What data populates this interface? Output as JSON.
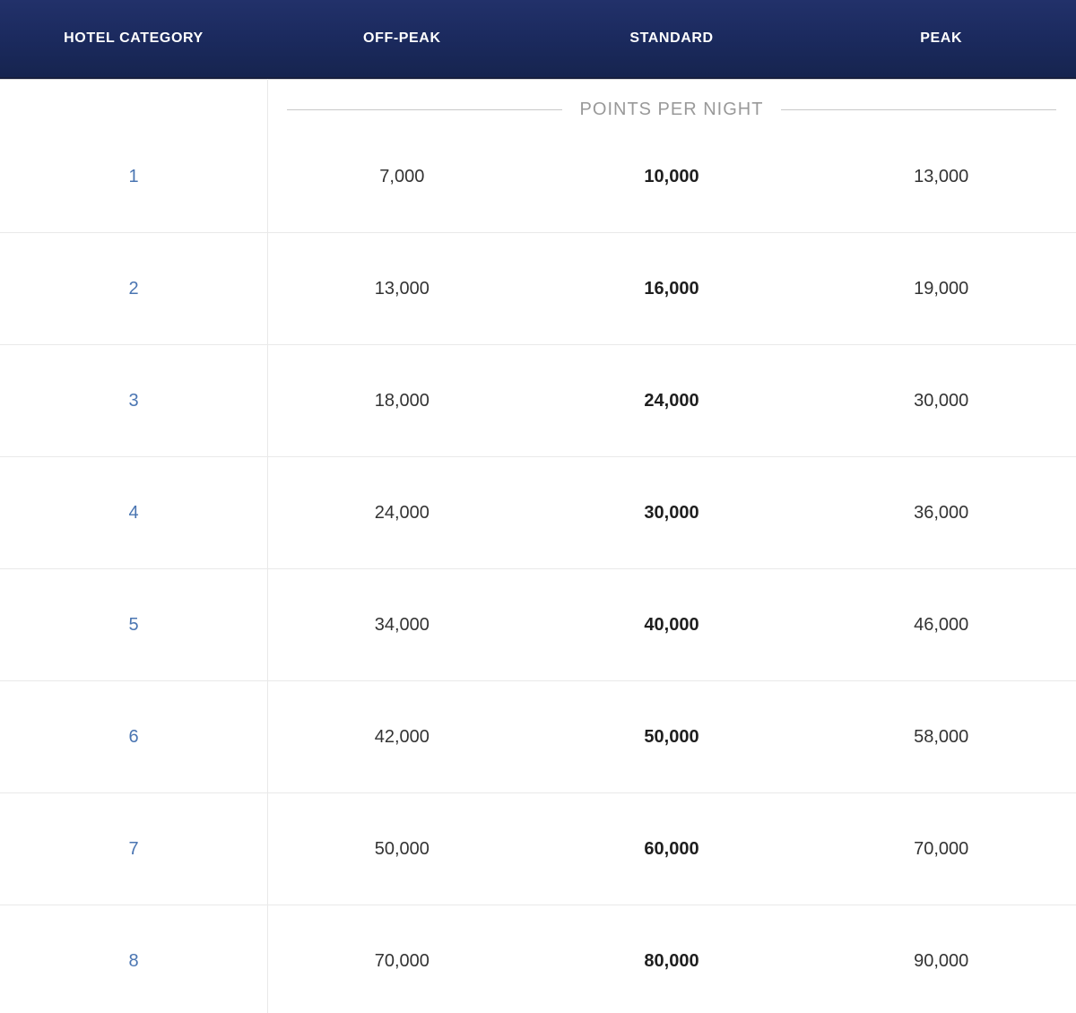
{
  "table": {
    "columns": [
      {
        "id": "hotel_category",
        "label": "HOTEL CATEGORY"
      },
      {
        "id": "off_peak",
        "label": "OFF-PEAK"
      },
      {
        "id": "standard",
        "label": "STANDARD"
      },
      {
        "id": "peak",
        "label": "PEAK"
      }
    ],
    "section_label": "POINTS PER NIGHT",
    "rows": [
      {
        "category": "1",
        "off_peak": "7,000",
        "standard": "10,000",
        "peak": "13,000"
      },
      {
        "category": "2",
        "off_peak": "13,000",
        "standard": "16,000",
        "peak": "19,000"
      },
      {
        "category": "3",
        "off_peak": "18,000",
        "standard": "24,000",
        "peak": "30,000"
      },
      {
        "category": "4",
        "off_peak": "24,000",
        "standard": "30,000",
        "peak": "36,000"
      },
      {
        "category": "5",
        "off_peak": "34,000",
        "standard": "40,000",
        "peak": "46,000"
      },
      {
        "category": "6",
        "off_peak": "42,000",
        "standard": "50,000",
        "peak": "58,000"
      },
      {
        "category": "7",
        "off_peak": "50,000",
        "standard": "60,000",
        "peak": "70,000"
      },
      {
        "category": "8",
        "off_peak": "70,000",
        "standard": "80,000",
        "peak": "90,000"
      }
    ]
  },
  "colors": {
    "header_background": "#1b2a5e",
    "header_text": "#ffffff",
    "category_link": "#4a75b2",
    "value_text": "#333333",
    "standard_value_text": "#1f1f1f",
    "section_label_text": "#999999",
    "row_divider_line": "#e9e9e9",
    "legend_line": "#c9c9c9"
  }
}
